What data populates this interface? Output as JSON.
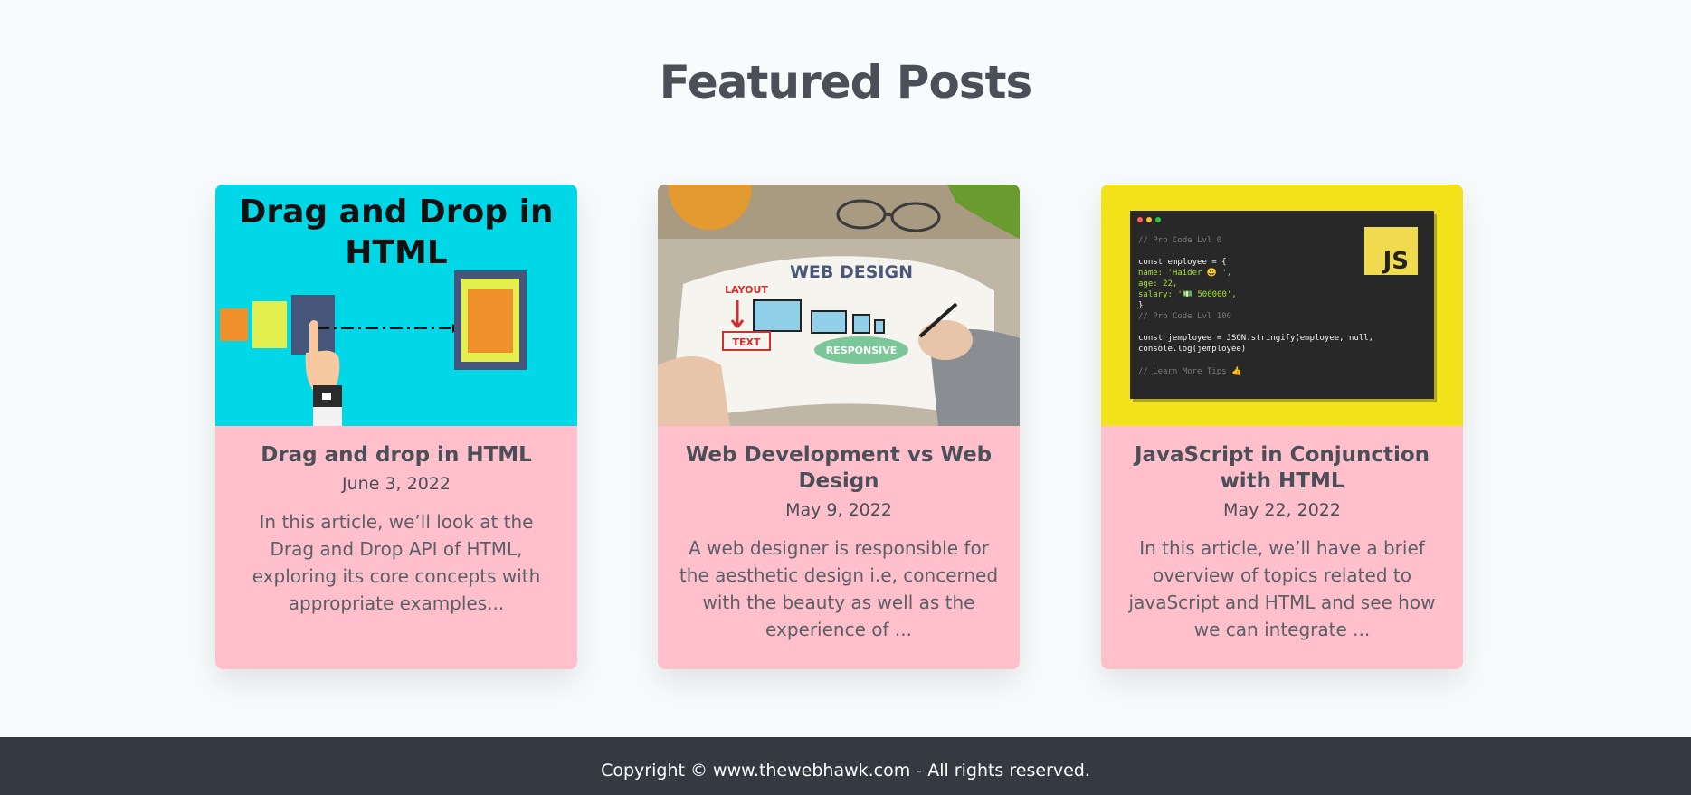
{
  "section": {
    "title": "Featured Posts"
  },
  "posts": [
    {
      "title": "Drag and drop in HTML",
      "date": "June 3, 2022",
      "excerpt": "In this article, we’ll look at the Drag and Drop API of HTML, exploring its core concepts with appropriate examples...",
      "image": {
        "heading_line1": "Drag and Drop in",
        "heading_line2": "HTML"
      }
    },
    {
      "title": "Web Development vs Web Design",
      "date": "May 9, 2022",
      "excerpt": "A web designer is responsible for the aesthetic design i.e, concerned with the beauty as well as the experience of ...",
      "image": {
        "heading": "WEB DESIGN",
        "label_layout": "LAYOUT",
        "label_text": "TEXT",
        "label_responsive": "RESPONSIVE"
      }
    },
    {
      "title": "JavaScript in Conjunction with HTML",
      "date": "May 22, 2022",
      "excerpt": "In this article, we’ll have a brief overview of topics related to javaScript and HTML and see how we can integrate ...",
      "image": {
        "badge": "JS",
        "code": {
          "line1": "// Pro Code Lvl 0",
          "line2": "const employee = {",
          "line3": "  name: 'Haider 😀 ',",
          "line4": "  age: 22,",
          "line5": "  salary: '💵 500000',",
          "line6": "}",
          "line7": "// Pro Code Lvl 100",
          "line8": "const jemployee = JSON.stringify(employee, null,",
          "line9": "console.log(jemployee)",
          "line10": "// Learn More Tips 👍"
        }
      }
    }
  ],
  "footer": {
    "text": "Copyright © www.thewebhawk.com - All rights reserved."
  },
  "colors": {
    "background": "#f7fbfb",
    "card": "#ffc0cb",
    "heading": "#4a4f58",
    "footer": "#353a42",
    "thumb1_bg": "#00d8e8",
    "thumb3_bg": "#f2e21a",
    "js_badge": "#f0db4f"
  }
}
